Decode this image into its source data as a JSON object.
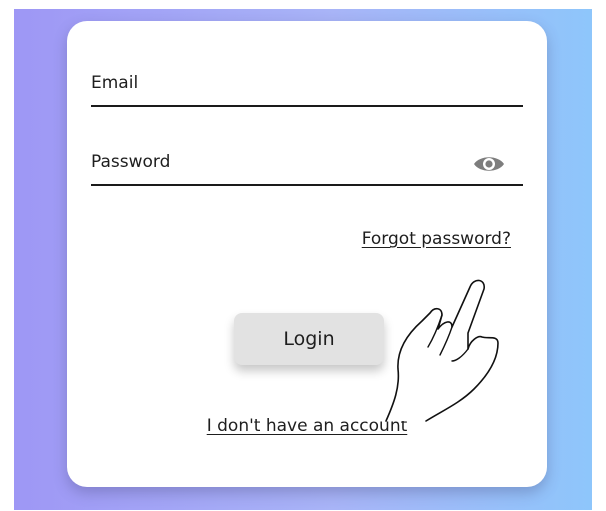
{
  "login_form": {
    "email_label": "Email",
    "password_label": "Password",
    "password_toggle_icon": "eye-icon",
    "forgot_password_link": "Forgot password?",
    "login_button": "Login",
    "no_account_link": "I don't have an account"
  },
  "overlay": {
    "pointer_icon": "pointing-hand-icon"
  },
  "colors": {
    "background_gradient_start": "#9e97f5",
    "background_gradient_end": "#8ec6fb",
    "card": "#ffffff",
    "button": "#e2e2e2",
    "text": "#1e1e1e"
  }
}
